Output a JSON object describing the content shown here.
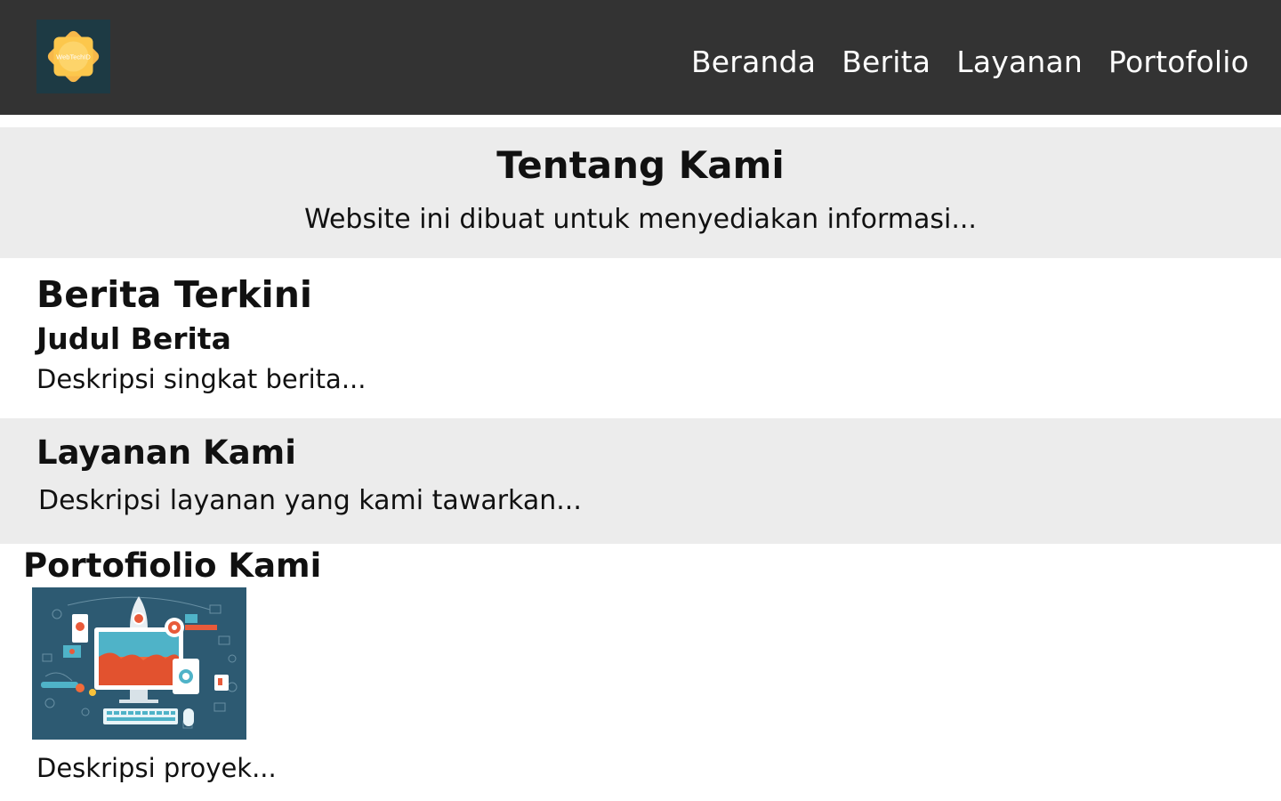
{
  "header": {
    "logo_text": "WebTechID",
    "nav": [
      "Beranda",
      "Berita",
      "Layanan",
      "Portofolio"
    ]
  },
  "about": {
    "title": "Tentang Kami",
    "text": "Website ini dibuat untuk menyediakan informasi..."
  },
  "news": {
    "title": "Berita Terkini",
    "item_title": "Judul Berita",
    "item_text": "Deskripsi singkat berita..."
  },
  "services": {
    "title": "Layanan Kami",
    "text": "Deskripsi layanan yang kami tawarkan..."
  },
  "portfolio": {
    "title": "Portofiolio Kami",
    "project_text": "Deskripsi proyek..."
  },
  "colors": {
    "header_bg": "#333333",
    "section_alt_bg": "#ececec",
    "logo_bg": "#1d3a44",
    "logo_accent": "#fcc74c",
    "illustration_bg": "#2d5a72"
  }
}
